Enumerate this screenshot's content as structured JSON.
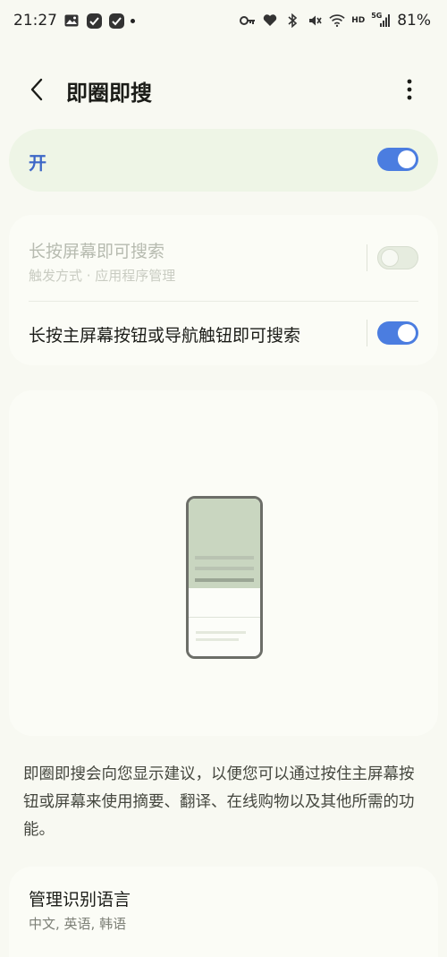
{
  "status_bar": {
    "time": "21:27",
    "network": "HD",
    "signal_type": "5G",
    "battery": "81%",
    "icons": [
      "gallery-icon",
      "app-check-icon",
      "app-check-icon",
      "notification-dot",
      "key-icon",
      "heart-icon",
      "bluetooth-icon",
      "mute-icon",
      "wifi-icon",
      "signal-icon"
    ]
  },
  "app_bar": {
    "title": "即圈即搜",
    "back_icon": "back-chevron-icon",
    "more_icon": "more-vert-icon"
  },
  "master_switch": {
    "label": "开",
    "enabled": true
  },
  "settings": [
    {
      "title": "长按屏幕即可搜索",
      "subtitle": "触发方式 · 应用程序管理",
      "enabled": false,
      "disabled_style": true
    },
    {
      "title": "长按主屏幕按钮或导航触钮即可搜索",
      "enabled": true
    }
  ],
  "description": "即圈即搜会向您显示建议，以便您可以通过按住主屏幕按钮或屏幕来使用摘要、翻译、在线购物以及其他所需的功能。",
  "language": {
    "title": "管理识别语言",
    "subtitle": "中文, 英语, 韩语"
  },
  "colors": {
    "accent": "#4b7de0",
    "master_bg": "#eef5e6",
    "background": "#f8f9f2"
  }
}
